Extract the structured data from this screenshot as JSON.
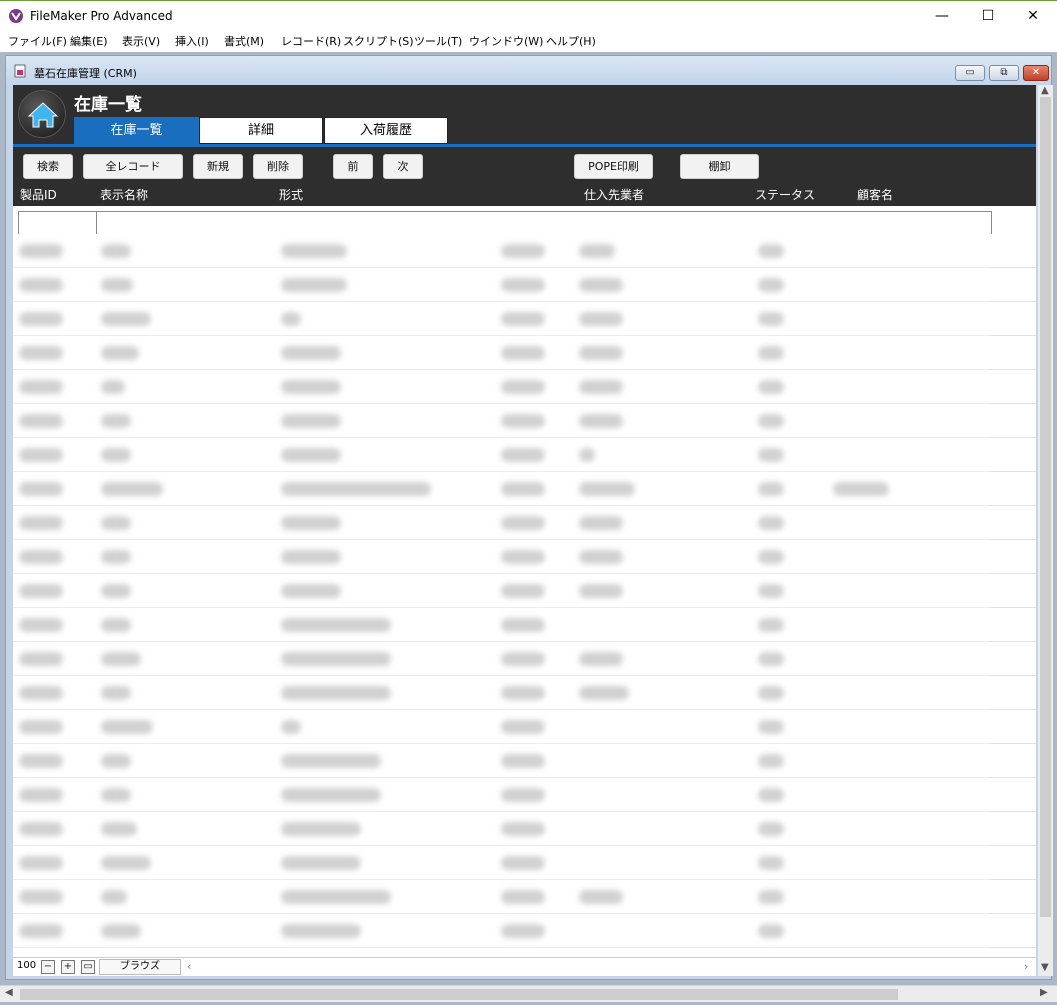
{
  "app": {
    "title": "FileMaker Pro Advanced",
    "window_controls": {
      "minimize": "—",
      "maximize": "☐",
      "close": "✕"
    }
  },
  "menu": [
    "ファイル(F)",
    "編集(E)",
    "表示(V)",
    "挿入(I)",
    "書式(M)",
    "レコード(R)",
    "スクリプト(S)",
    "ツール(T)",
    "ウインドウ(W)",
    "ヘルプ(H)"
  ],
  "document": {
    "title": "墓石在庫管理 (CRM)",
    "controls": {
      "minimize": "▭",
      "restore": "⧉",
      "close": "✕"
    }
  },
  "layout": {
    "title": "在庫一覧",
    "tabs": [
      {
        "label": "在庫一覧",
        "active": true
      },
      {
        "label": "詳細",
        "active": false
      },
      {
        "label": "入荷履歴",
        "active": false
      }
    ],
    "buttons": {
      "search": "検索",
      "all_records": "全レコード",
      "new": "新規",
      "delete": "削除",
      "prev": "前",
      "next": "次",
      "pop_print": "POPE印刷",
      "stock_take": "棚卸"
    },
    "columns": {
      "product_id": "製品ID",
      "display_name": "表示名称",
      "format": "形式",
      "supplier": "仕入先業者",
      "status": "ステータス",
      "customer": "顧客名"
    }
  },
  "statusbar": {
    "zoom": "100",
    "mode": "ブラウズ"
  },
  "colors": {
    "header_bg": "#2e2e2e",
    "accent": "#1a6ec0",
    "mdi_bg": "#abb8c8"
  }
}
